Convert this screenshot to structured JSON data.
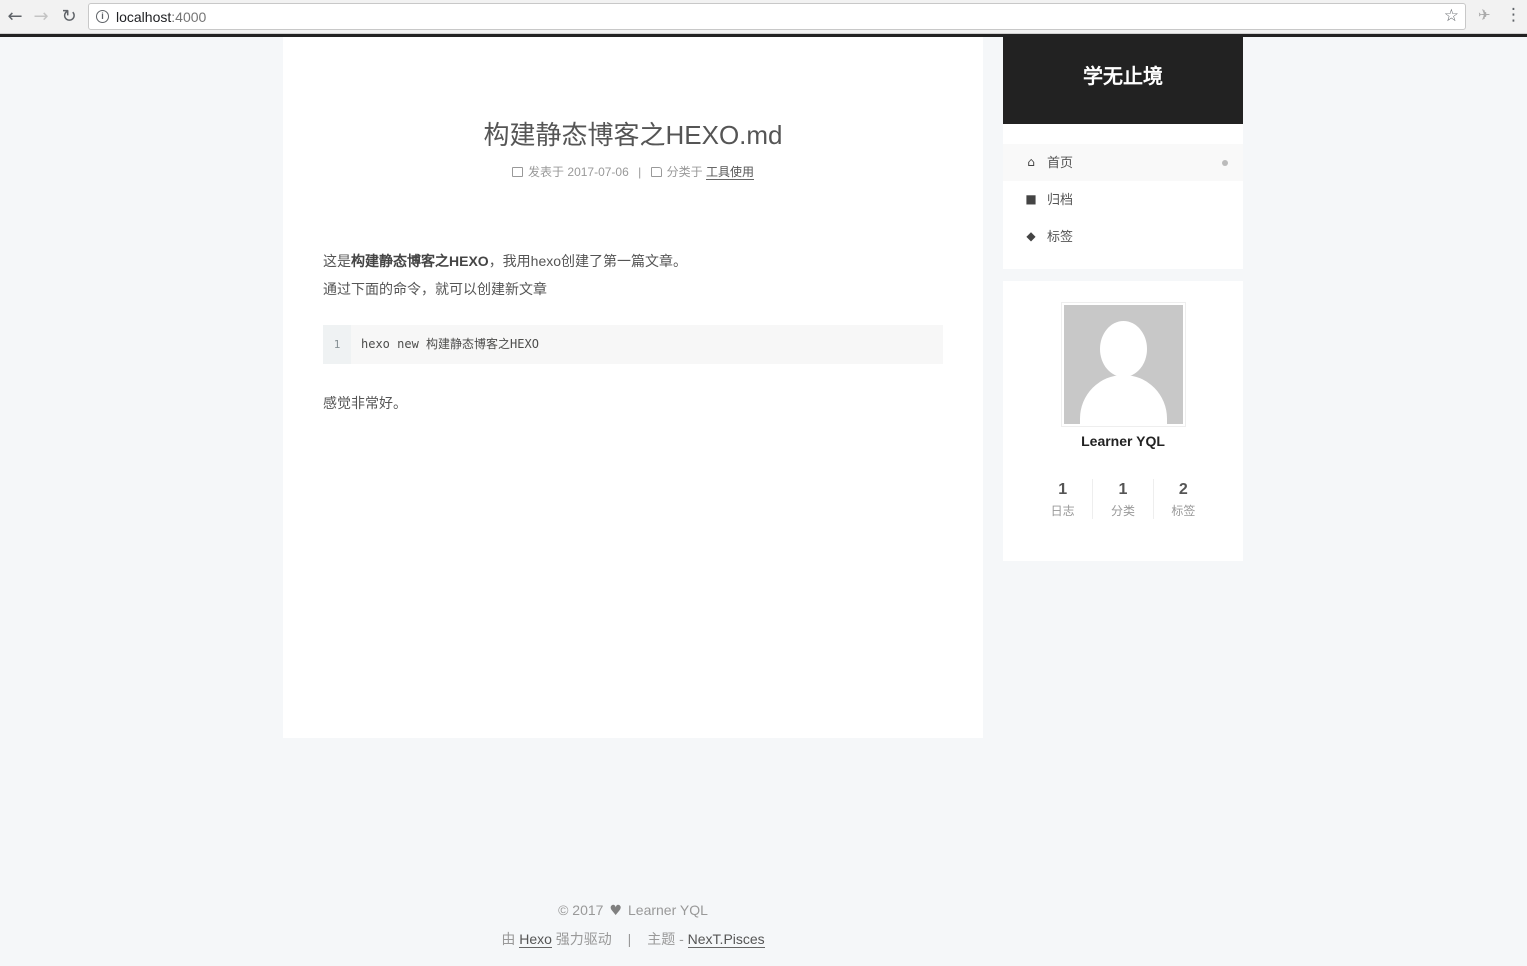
{
  "browser": {
    "url_host": "localhost",
    "url_port": ":4000"
  },
  "post": {
    "title": "构建静态博客之HEXO.md",
    "meta_posted_label": "发表于",
    "meta_date": "2017-07-06",
    "meta_separator": "|",
    "meta_category_label": "分类于",
    "meta_category": "工具使用",
    "body_p1_prefix": "这是",
    "body_p1_bold": "构建静态博客之HEXO",
    "body_p1_suffix": "，我用hexo创建了第一篇文章。",
    "body_p2": "通过下面的命令，就可以创建新文章",
    "code_line_number": "1",
    "code_text": "hexo new 构建静态博客之HEXO",
    "body_p3": "感觉非常好。"
  },
  "sidebar": {
    "brand": "学无止境",
    "menu": [
      {
        "label": "首页",
        "icon": "home-icon",
        "active": true
      },
      {
        "label": "归档",
        "icon": "archive-icon",
        "active": false
      },
      {
        "label": "标签",
        "icon": "tags-icon",
        "active": false
      }
    ],
    "author": {
      "name": "Learner YQL",
      "stats": [
        {
          "num": "1",
          "label": "日志"
        },
        {
          "num": "1",
          "label": "分类"
        },
        {
          "num": "2",
          "label": "标签"
        }
      ]
    }
  },
  "footer": {
    "copyright": "© 2017",
    "author": "Learner YQL",
    "powered_prefix": "由",
    "powered_link": "Hexo",
    "powered_suffix": "强力驱动",
    "separator": "|",
    "theme_prefix": "主题 -",
    "theme_link": "NexT.Pisces"
  }
}
